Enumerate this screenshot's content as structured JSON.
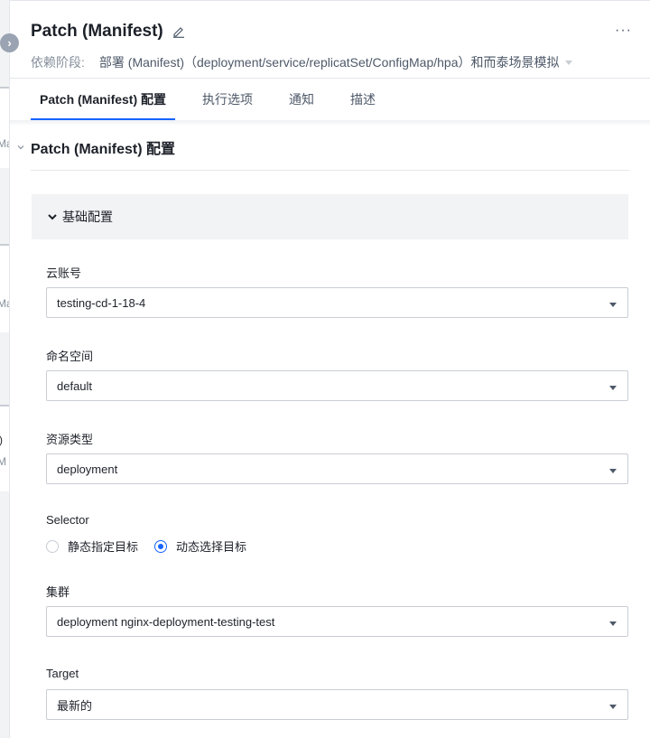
{
  "header": {
    "title": "Patch (Manifest)",
    "dependency_label": "依赖阶段:",
    "dependency_value": "部署 (Manifest)（deployment/service/replicatSet/ConfigMap/hpa）和而泰场景模拟"
  },
  "background": {
    "fragments": [
      "Ma",
      "Ma",
      ")",
      "M"
    ]
  },
  "tabs": [
    {
      "label": "Patch (Manifest) 配置",
      "active": true
    },
    {
      "label": "执行选项",
      "active": false
    },
    {
      "label": "通知",
      "active": false
    },
    {
      "label": "描述",
      "active": false
    }
  ],
  "section": {
    "title": "Patch (Manifest) 配置"
  },
  "group": {
    "title": "基础配置"
  },
  "fields": {
    "account": {
      "label": "云账号",
      "value": "testing-cd-1-18-4"
    },
    "namespace": {
      "label": "命名空间",
      "value": "default"
    },
    "resource_type": {
      "label": "资源类型",
      "value": "deployment"
    },
    "selector": {
      "label": "Selector",
      "options": [
        "静态指定目标",
        "动态选择目标"
      ],
      "selected": "动态选择目标"
    },
    "cluster": {
      "label": "集群",
      "value": "deployment nginx-deployment-testing-test"
    },
    "target": {
      "label": "Target",
      "value": "最新的"
    }
  },
  "colors": {
    "accent": "#1664ff",
    "border": "#c9cdd4",
    "group_bg": "#f2f3f5"
  }
}
